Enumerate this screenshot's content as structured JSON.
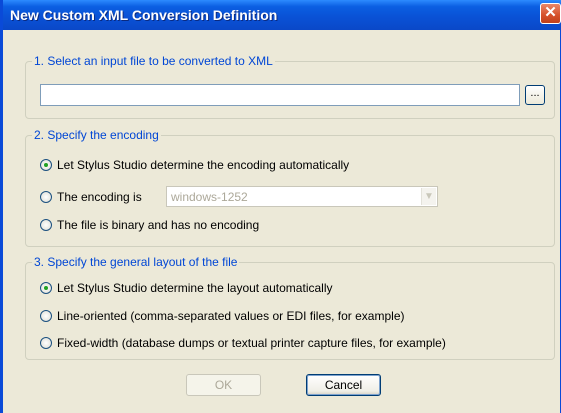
{
  "window": {
    "title": "New Custom XML Conversion Definition",
    "close_icon": "close-icon"
  },
  "section1": {
    "legend": "1. Select an input file to be converted to XML",
    "input_value": "",
    "browse_label": "..."
  },
  "section2": {
    "legend": "2. Specify the encoding",
    "options": [
      {
        "label": "Let Stylus Studio determine the encoding automatically",
        "checked": true
      },
      {
        "label": "The encoding is",
        "checked": false
      },
      {
        "label": "The file is binary and has no encoding",
        "checked": false
      }
    ],
    "encoding_select": {
      "value": "windows-1252",
      "enabled": false
    }
  },
  "section3": {
    "legend": "3. Specify the general layout of the file",
    "options": [
      {
        "label": "Let Stylus Studio determine the layout automatically",
        "checked": true
      },
      {
        "label": "Line-oriented (comma-separated values or EDI files, for example)",
        "checked": false
      },
      {
        "label": "Fixed-width (database dumps or textual printer capture files, for example)",
        "checked": false
      }
    ]
  },
  "buttons": {
    "ok_label": "OK",
    "ok_enabled": false,
    "cancel_label": "Cancel"
  },
  "colors": {
    "titlebar": "#0a52d6",
    "legend_text": "#0046d5",
    "dialog_bg": "#ece9d8",
    "radio_dot": "#21a121"
  }
}
